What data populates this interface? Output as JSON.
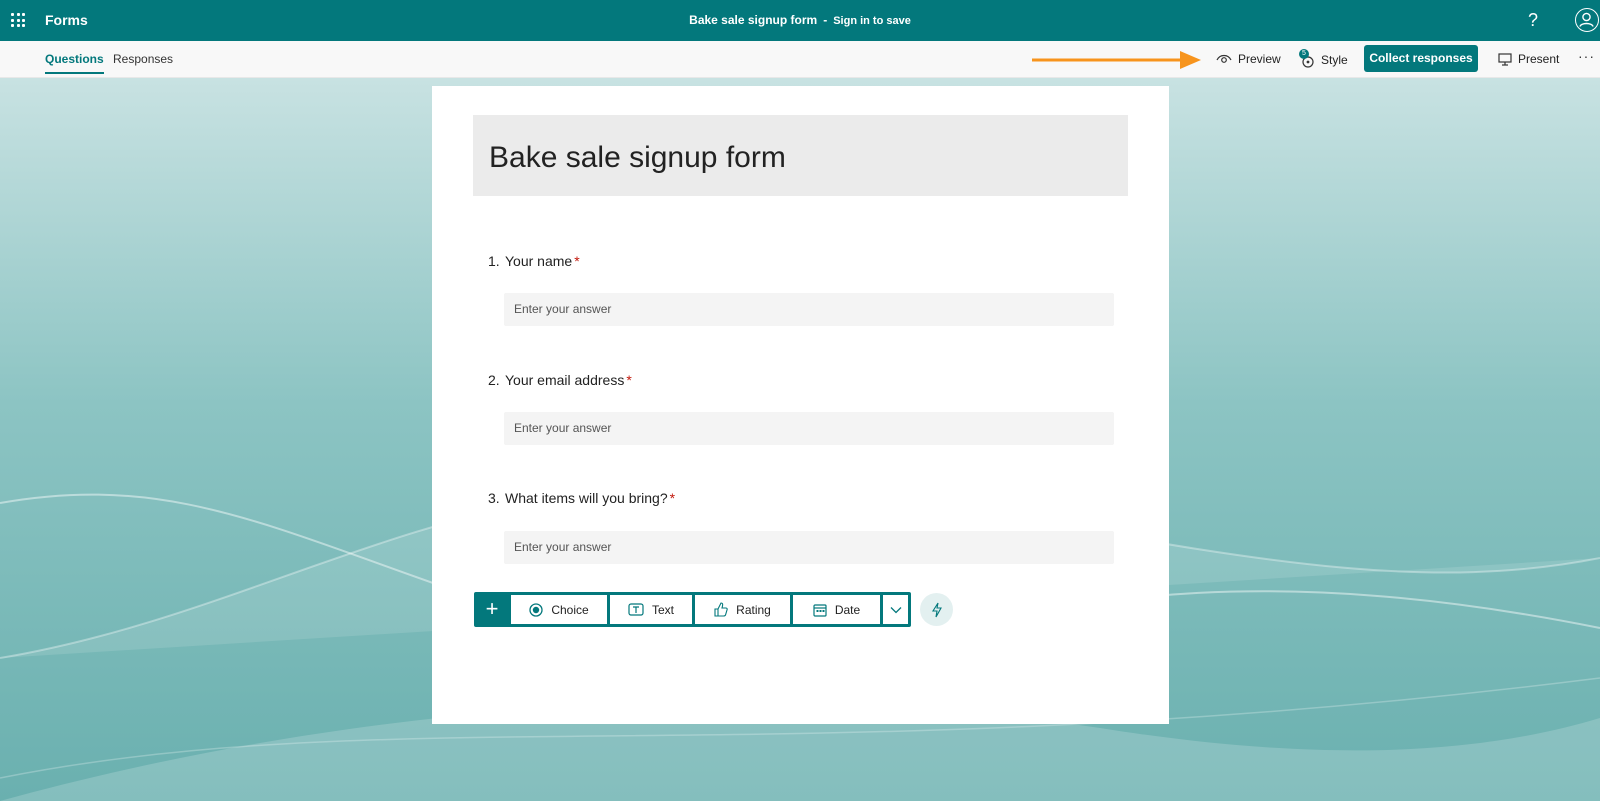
{
  "topbar": {
    "app_name": "Forms",
    "form_title": "Bake sale signup form",
    "separator": "-",
    "signin_text": "Sign in to save",
    "help_label": "?"
  },
  "subbar": {
    "tabs": [
      {
        "label": "Questions",
        "active": true
      },
      {
        "label": "Responses",
        "active": false
      }
    ],
    "preview_label": "Preview",
    "style_label": "Style",
    "style_badge": "5",
    "collect_label": "Collect responses",
    "present_label": "Present",
    "more_label": "···"
  },
  "form": {
    "title": "Bake sale signup form",
    "questions": [
      {
        "number": "1.",
        "text": "Your name",
        "required_mark": "*",
        "placeholder": "Enter your answer"
      },
      {
        "number": "2.",
        "text": "Your email address",
        "required_mark": "*",
        "placeholder": "Enter your answer"
      },
      {
        "number": "3.",
        "text": "What items will you bring?",
        "required_mark": "*",
        "placeholder": "Enter your answer"
      }
    ],
    "add_bar": {
      "plus": "+",
      "types": [
        "Choice",
        "Text",
        "Rating",
        "Date"
      ]
    }
  },
  "colors": {
    "brand": "#03787c",
    "required": "#c2180c",
    "arrow": "#f7941d"
  }
}
